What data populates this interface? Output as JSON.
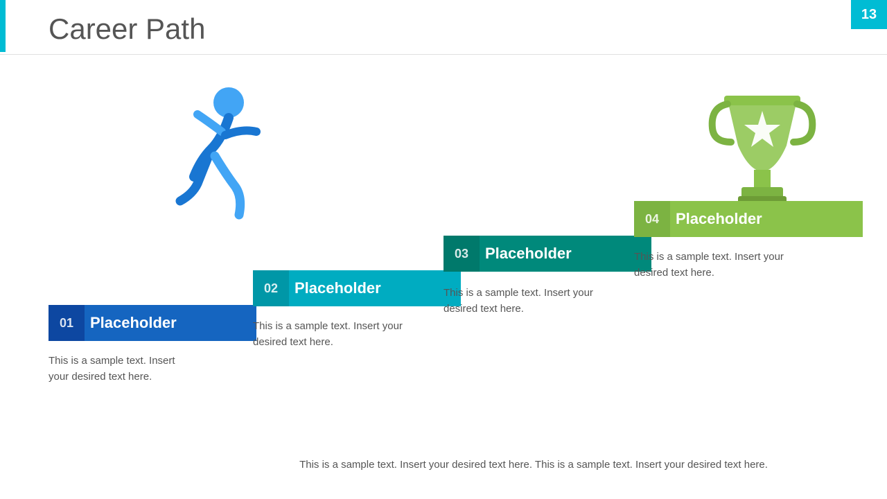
{
  "slide": {
    "title": "Career Path",
    "slide_number": "13",
    "accent_color": "#00bcd4"
  },
  "steps": [
    {
      "number": "01",
      "label": "Placeholder",
      "bar_color": "#1976d2",
      "num_color": "#1565c0",
      "desc": "This is a sample text. Insert your desired text here."
    },
    {
      "number": "02",
      "label": "Placeholder",
      "bar_color": "#00bcd4",
      "num_color": "#00acc1",
      "desc": "This is a sample text. Insert your desired text here."
    },
    {
      "number": "03",
      "label": "Placeholder",
      "bar_color": "#00bfa5",
      "num_color": "#00897b",
      "desc": "This is a sample text. Insert your desired text here."
    },
    {
      "number": "04",
      "label": "Placeholder",
      "bar_color": "#8bc34a",
      "num_color": "#7cb342",
      "desc": "This is a sample text. Insert your desired text here."
    }
  ],
  "bottom_text": "This is a sample text. Insert your desired text here. This is a sample text. Insert your desired text here.",
  "icons": {
    "runner": "runner-icon",
    "trophy": "trophy-icon"
  }
}
